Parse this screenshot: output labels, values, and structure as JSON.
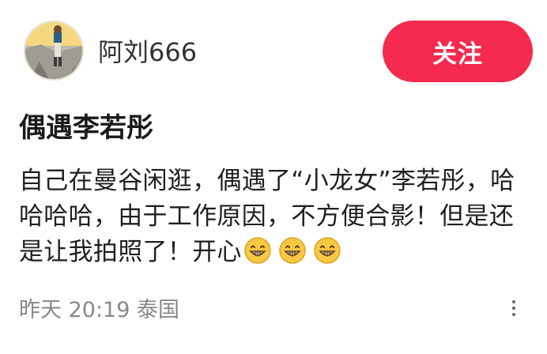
{
  "header": {
    "username": "阿刘666",
    "follow_label": "关注"
  },
  "post": {
    "title": "偶遇李若彤",
    "body": "自己在曼谷闲逛，偶遇了“小龙女”李若彤，哈哈哈哈，由于工作原因，不方便合影！但是还是让我拍照了！开心",
    "emoji_count": 3
  },
  "footer": {
    "meta": "昨天 20:19 泰国"
  },
  "icons": {
    "avatar": "avatar-photo",
    "emoji": "grinning-face-icon",
    "more": "more-vertical-icon"
  },
  "colors": {
    "accent": "#f42a4e",
    "text": "#1f1f1f",
    "meta": "#888888"
  }
}
